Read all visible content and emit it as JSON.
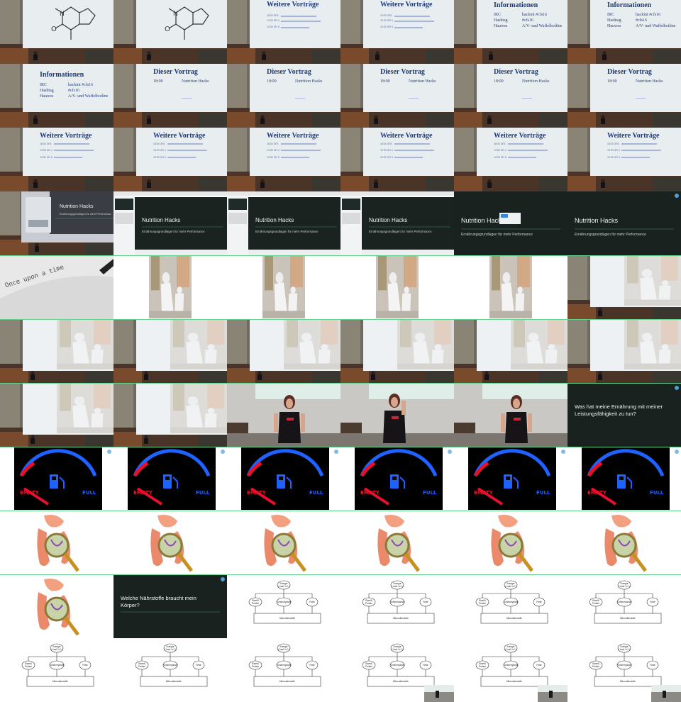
{
  "grid": {
    "columns": 6,
    "rows": 11
  },
  "slides": {
    "caffeine": {
      "label": "caffeine molecule slide"
    },
    "informationen": {
      "title": "Informationen",
      "rows": [
        {
          "key": "IRC",
          "value": "hackint #cfs16"
        },
        {
          "key": "Hashtag",
          "value": "#cfs16"
        },
        {
          "key": "Hauwes",
          "value": "A/V- und Waffelhotline"
        }
      ]
    },
    "weitere": {
      "title": "Weitere Vorträge",
      "rows": [
        {
          "time": "18:00",
          "room": "SR1"
        },
        {
          "time": "19:00",
          "room": "SR 4"
        },
        {
          "time": "19:00",
          "room": "SR 5"
        }
      ]
    },
    "dieser": {
      "title": "Dieser Vortrag",
      "time": "18:00",
      "talk": "Nutrition Hacks"
    },
    "nutrition": {
      "title": "Nutrition Hacks",
      "subtitle": "Ernährungsgrundlagen für mehr Performance"
    },
    "once": {
      "text": "Once upon a time"
    },
    "question1": {
      "text": "Was hat meine Ernährung mit meiner Leistungsfähigkeit zu tun?"
    },
    "question2": {
      "text": "Welche Nährstoffe braucht mein Körper?"
    },
    "gauge": {
      "empty": "EMPTY",
      "full": "FULL"
    },
    "diagram": {
      "top_line1": "Energie",
      "top_line2": "( kcal / kJ )",
      "left_line1": "Eiweiß",
      "left_line2": "Protein",
      "middle": "Kohlenhydrate",
      "right": "Fette",
      "bottom": "Mikronährstoffe"
    }
  },
  "cells": [
    "caffeine",
    "caffeine",
    "weitere_top",
    "weitere_top",
    "info_top",
    "info_top",
    "info",
    "dieser",
    "dieser",
    "dieser",
    "dieser",
    "dieser",
    "weitere",
    "weitere",
    "weitere",
    "weitere",
    "weitere",
    "weitere",
    "proj_nutrition",
    "screen_nutrition",
    "screen_nutrition",
    "screen_nutrition",
    "dark_nutrition_dialog",
    "dark_nutrition",
    "once",
    "statues_white",
    "statues_white",
    "statues_white",
    "statues_white",
    "room_statues",
    "room_statues",
    "room_statues",
    "room_statues",
    "room_statues",
    "room_statues",
    "room_statues",
    "room_statues",
    "room_statues",
    "speaker",
    "speaker2",
    "speaker",
    "question1",
    "gauge",
    "gauge",
    "gauge",
    "gauge",
    "gauge",
    "gauge",
    "gut",
    "gut",
    "gut",
    "gut",
    "gut",
    "gut",
    "gut",
    "question2",
    "diagram",
    "diagram",
    "diagram",
    "diagram",
    "diagram",
    "diagram",
    "diagram",
    "diagram_pip",
    "diagram_pip",
    "diagram_pip"
  ]
}
